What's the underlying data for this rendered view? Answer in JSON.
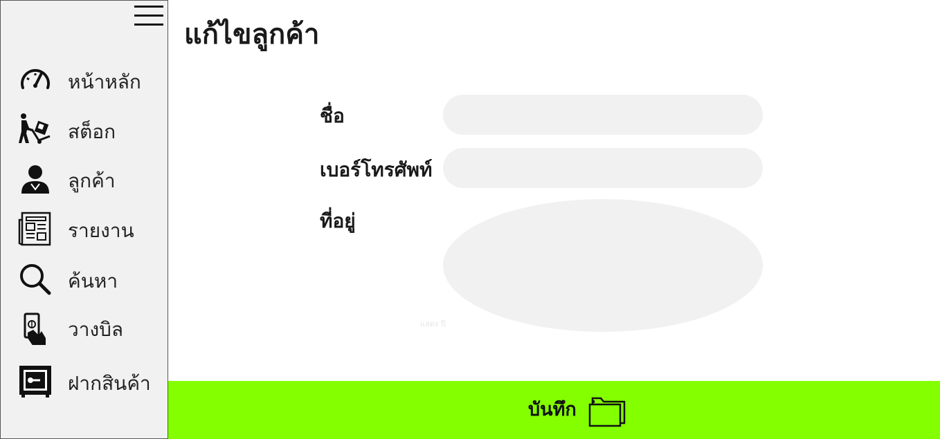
{
  "sidebar": {
    "items": [
      {
        "label": "หน้าหลัก",
        "icon": "speedometer-icon"
      },
      {
        "label": "สต็อก",
        "icon": "hand-truck-icon"
      },
      {
        "label": "ลูกค้า",
        "icon": "user-icon"
      },
      {
        "label": "รายงาน",
        "icon": "newspaper-icon"
      },
      {
        "label": "ค้นหา",
        "icon": "search-icon"
      },
      {
        "label": "วางบิล",
        "icon": "hand-money-icon"
      },
      {
        "label": "ฝากสินค้า",
        "icon": "safe-icon"
      }
    ]
  },
  "page": {
    "title": "แก้ไขลูกค้า"
  },
  "form": {
    "name_label": "ชื่อ",
    "name_value": "",
    "phone_label": "เบอร์โทรศัพท์",
    "phone_value": "",
    "address_label": "ที่อยู่",
    "address_value": "",
    "address_ghost_text": "แสดง ปี"
  },
  "footer": {
    "save_label": "บันทึก",
    "save_icon": "folder-icon"
  },
  "colors": {
    "sidebar_bg": "#f1f1f1",
    "accent": "#84ff00",
    "field_bg": "#f1f1f1"
  }
}
